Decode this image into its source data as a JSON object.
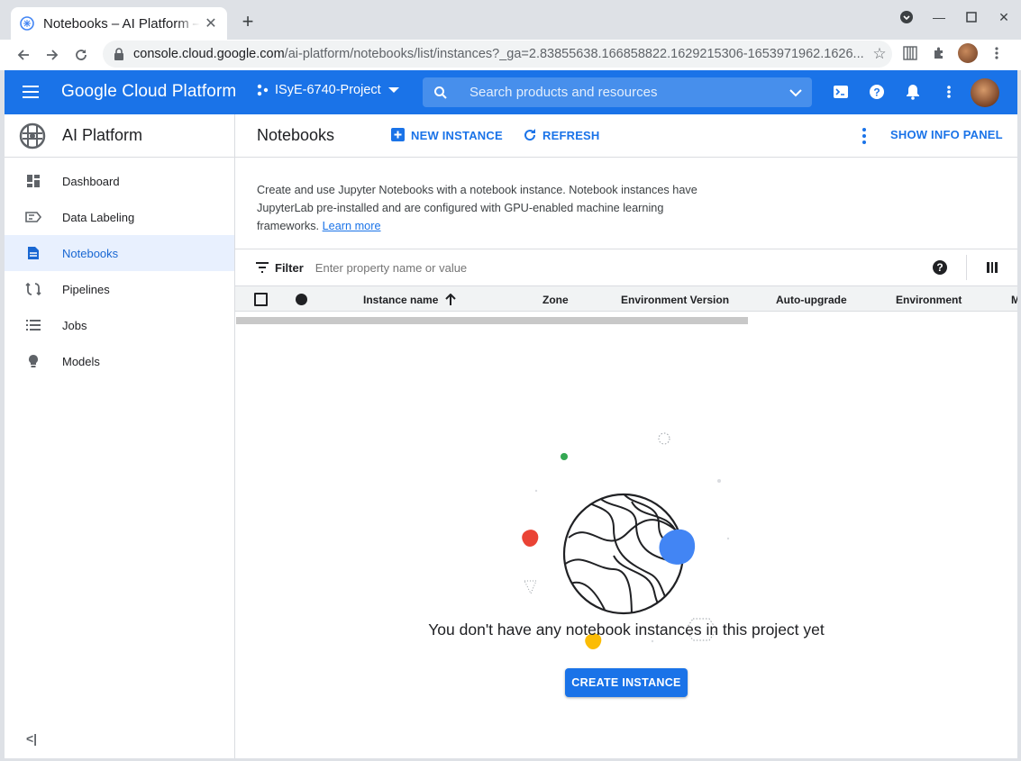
{
  "browser": {
    "tab_title": "Notebooks – AI Platform – ",
    "url_host": "console.cloud.google.com",
    "url_path": "/ai-platform/notebooks/list/instances?_ga=2.83855638.166858822.1629215306-1653971962.1626..."
  },
  "header": {
    "logo": "Google Cloud Platform",
    "project": "ISyE-6740-Project",
    "search_placeholder": "Search products and resources"
  },
  "sidebar": {
    "product_name": "AI Platform",
    "items": [
      {
        "label": "Dashboard",
        "icon": "dashboard-icon"
      },
      {
        "label": "Data Labeling",
        "icon": "label-icon"
      },
      {
        "label": "Notebooks",
        "icon": "notebook-icon",
        "active": true
      },
      {
        "label": "Pipelines",
        "icon": "pipeline-icon"
      },
      {
        "label": "Jobs",
        "icon": "list-icon"
      },
      {
        "label": "Models",
        "icon": "lightbulb-icon"
      }
    ],
    "collapse_label": "<|"
  },
  "main": {
    "title": "Notebooks",
    "new_instance": "NEW INSTANCE",
    "refresh": "REFRESH",
    "show_info_panel": "SHOW INFO PANEL",
    "description": "Create and use Jupyter Notebooks with a notebook instance. Notebook instances have JupyterLab pre-installed and are configured with GPU-enabled machine learning frameworks.",
    "learn_more": "Learn more",
    "filter_label": "Filter",
    "filter_placeholder": "Enter property name or value",
    "columns": [
      "Instance name",
      "Zone",
      "Environment Version",
      "Auto-upgrade",
      "Environment",
      "M"
    ],
    "empty_message": "You don't have any notebook instances in this project yet",
    "create_button": "CREATE INSTANCE"
  },
  "colors": {
    "brand_blue": "#1a73e8",
    "active_bg": "#e8f0fe"
  }
}
